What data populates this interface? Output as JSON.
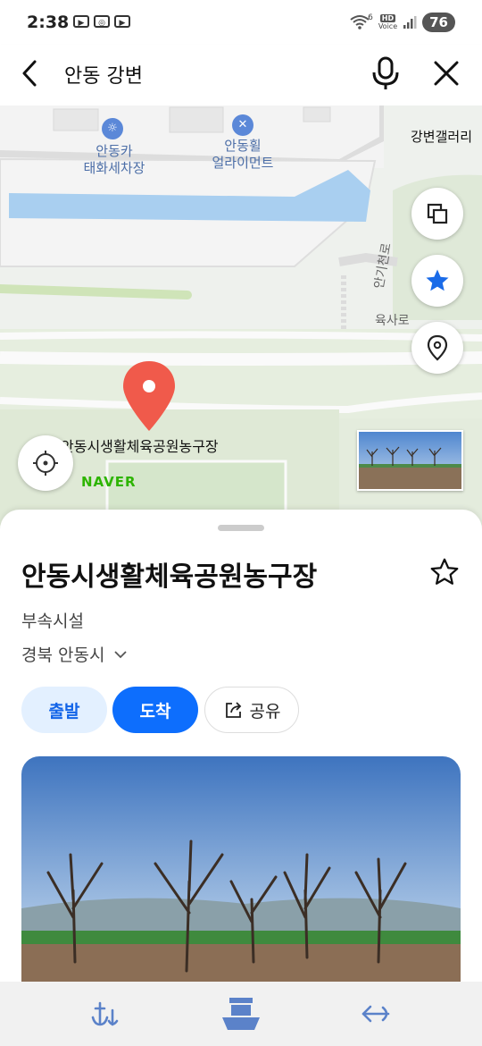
{
  "status_bar": {
    "time": "2:38",
    "battery": "76",
    "hd_label": "HD",
    "voice_label": "Voice",
    "wifi_badge": "6"
  },
  "search": {
    "query": "안동 강변"
  },
  "map": {
    "labels": {
      "carwash_line1": "안동카",
      "carwash_line2": "태화세차장",
      "wheel_line1": "안동휠",
      "wheel_line2": "얼라이먼트",
      "gallery": "강변갤러리",
      "road1": "안기천로",
      "road2": "육사로",
      "pin_label": "안동시생활체육공원농구장"
    },
    "brand": "NAVER"
  },
  "place": {
    "title": "안동시생활체육공원농구장",
    "category": "부속시설",
    "region": "경북 안동시",
    "buttons": {
      "start": "출발",
      "arrive": "도착",
      "share": "공유"
    }
  },
  "colors": {
    "accent": "#0d6efd",
    "pin": "#f05a4b",
    "naver": "#2db400"
  }
}
